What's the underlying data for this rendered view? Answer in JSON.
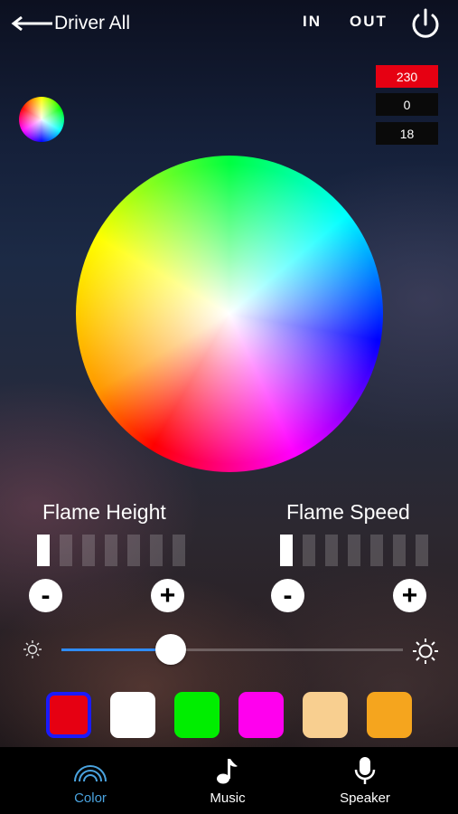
{
  "header": {
    "back_label": "Driver All",
    "in_label": "IN",
    "out_label": "OUT"
  },
  "rgb": {
    "r": "230",
    "g": "0",
    "b": "18",
    "r_color": "#e60012"
  },
  "flame_height": {
    "title": "Flame Height",
    "level": 1,
    "max": 7,
    "minus": "-",
    "plus": "+"
  },
  "flame_speed": {
    "title": "Flame Speed",
    "level": 1,
    "max": 7,
    "minus": "-",
    "plus": "+"
  },
  "brightness": {
    "value_fraction": 0.32,
    "accent": "#2f8cff"
  },
  "swatches": [
    "#e60012",
    "#ffffff",
    "#00ee00",
    "#ff00ee",
    "#f8cf90",
    "#f5a51e"
  ],
  "tabs": [
    {
      "label": "Color",
      "icon": "rainbow-icon",
      "active": true,
      "color": "#4aa3df"
    },
    {
      "label": "Music",
      "icon": "music-note-icon",
      "active": false,
      "color": "#ffffff"
    },
    {
      "label": "Speaker",
      "icon": "microphone-icon",
      "active": false,
      "color": "#ffffff"
    }
  ]
}
